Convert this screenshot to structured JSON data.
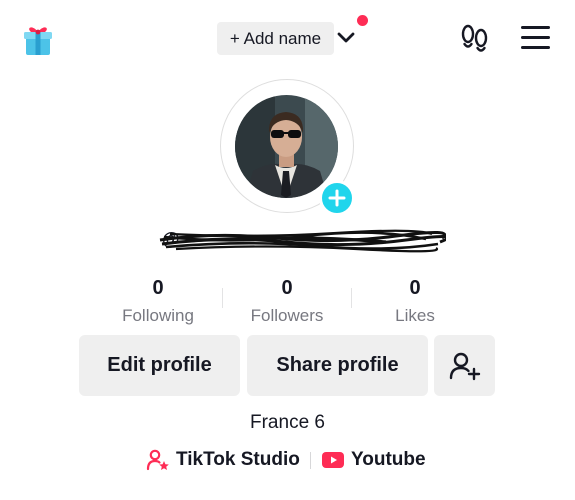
{
  "header": {
    "add_name_label": "+ Add name",
    "gift_icon": "gift-box-icon",
    "chevron_icon": "chevron-down-icon",
    "footprints_icon": "footprints-icon",
    "menu_icon": "hamburger-menu-icon",
    "notification_dot_color": "#fe2c55"
  },
  "profile": {
    "avatar_badge_icon": "plus-icon",
    "avatar_badge_color": "#20d5ec",
    "username": "@",
    "username_note": "redacted"
  },
  "stats": [
    {
      "value": "0",
      "label": "Following"
    },
    {
      "value": "0",
      "label": "Followers"
    },
    {
      "value": "0",
      "label": "Likes"
    }
  ],
  "actions": {
    "edit_profile": "Edit profile",
    "share_profile": "Share profile",
    "add_friend_icon": "add-user-icon"
  },
  "bio": "France 6",
  "links": {
    "studio_label": "TikTok Studio",
    "studio_icon": "person-star-icon",
    "youtube_label": "Youtube",
    "youtube_icon": "youtube-icon",
    "accent_color": "#fe2c55"
  }
}
